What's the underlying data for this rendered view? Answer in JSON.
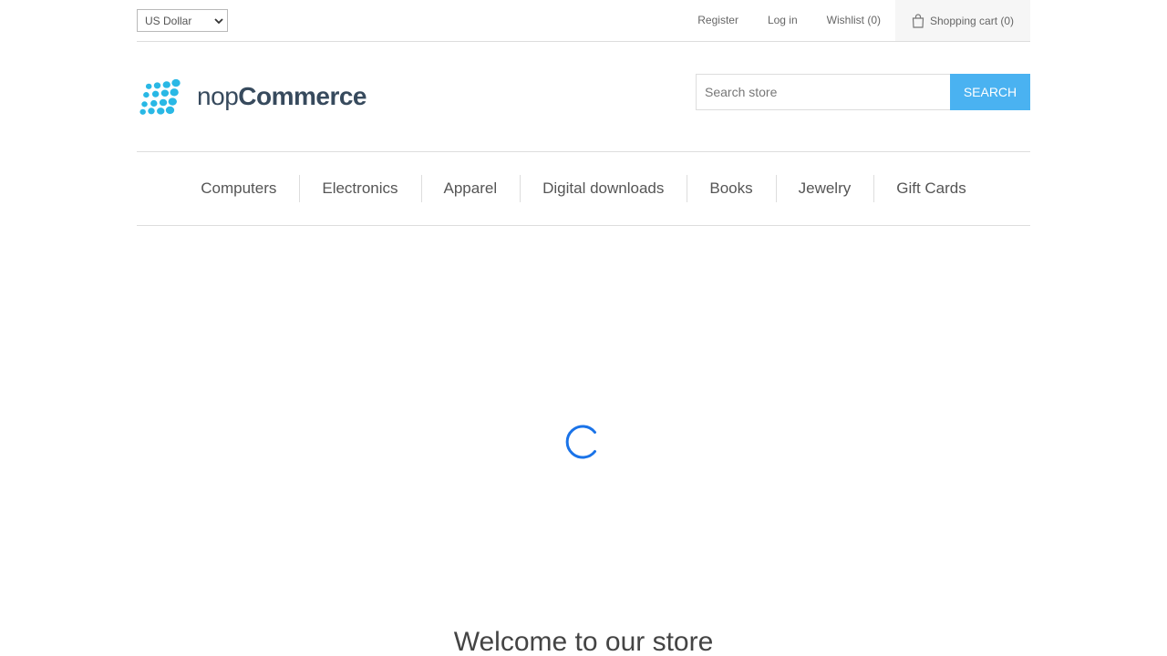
{
  "header": {
    "currency": {
      "selected": "US Dollar"
    },
    "links": {
      "register": "Register",
      "login": "Log in",
      "wishlist": "Wishlist (0)",
      "cart": "Shopping cart (0)"
    }
  },
  "logo": {
    "text_light": "nop",
    "text_bold": "Commerce",
    "color": "#29b8e5"
  },
  "search": {
    "placeholder": "Search store",
    "value": "",
    "button_label": "Search"
  },
  "menu": {
    "items": [
      "Computers",
      "Electronics",
      "Apparel",
      "Digital downloads",
      "Books",
      "Jewelry",
      "Gift Cards"
    ]
  },
  "loader": {
    "icon": "loading-spinner-icon",
    "color": "#1a73e8"
  },
  "main": {
    "welcome_title": "Welcome to our store"
  },
  "colors": {
    "accent": "#4ab2f1",
    "border": "#dddddd"
  }
}
